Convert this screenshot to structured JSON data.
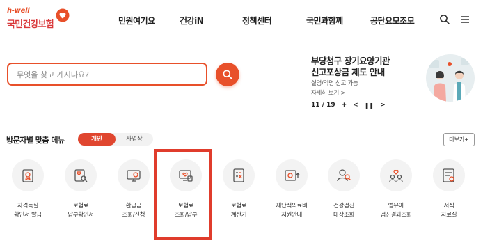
{
  "header": {
    "logo_en": "h-well",
    "logo_ko": "국민건강보험",
    "nav": [
      "민원여기요",
      "건강iN",
      "정책센터",
      "국민과함께",
      "공단요모조모"
    ]
  },
  "search": {
    "placeholder": "무엇을 찾고 계시나요?"
  },
  "banner": {
    "title_line1": "부당청구 장기요양기관",
    "title_line2": "신고포상금 제도 안내",
    "subtitle": "실명/익명 신고 가능",
    "more": "자세히 보기 >",
    "page_current": "11",
    "page_total": "19"
  },
  "menu": {
    "title": "방문자별 맞춤 메뉴",
    "tab_active": "개인",
    "tab_inactive": "사업장",
    "more_button": "더보기+",
    "items": [
      {
        "line1": "자격득실",
        "line2": "확인서 발급",
        "icon": "certificate-icon"
      },
      {
        "line1": "보험료",
        "line2": "납부확인서",
        "icon": "document-search-icon"
      },
      {
        "line1": "환급금",
        "line2": "조회/신청",
        "icon": "refund-monitor-icon"
      },
      {
        "line1": "보험료",
        "line2": "조회/납부",
        "icon": "payment-icon"
      },
      {
        "line1": "보험료",
        "line2": "계산기",
        "icon": "calculator-icon"
      },
      {
        "line1": "재난적의료비",
        "line2": "지원안내",
        "icon": "medical-cost-icon"
      },
      {
        "line1": "건강검진",
        "line2": "대상조회",
        "icon": "checkup-person-icon"
      },
      {
        "line1": "영유아",
        "line2": "검진결과조회",
        "icon": "infant-checkup-icon"
      },
      {
        "line1": "서식",
        "line2": "자료실",
        "icon": "forms-library-icon"
      }
    ]
  },
  "colors": {
    "accent": "#e8502a",
    "highlight_box": "#e03c2c"
  }
}
